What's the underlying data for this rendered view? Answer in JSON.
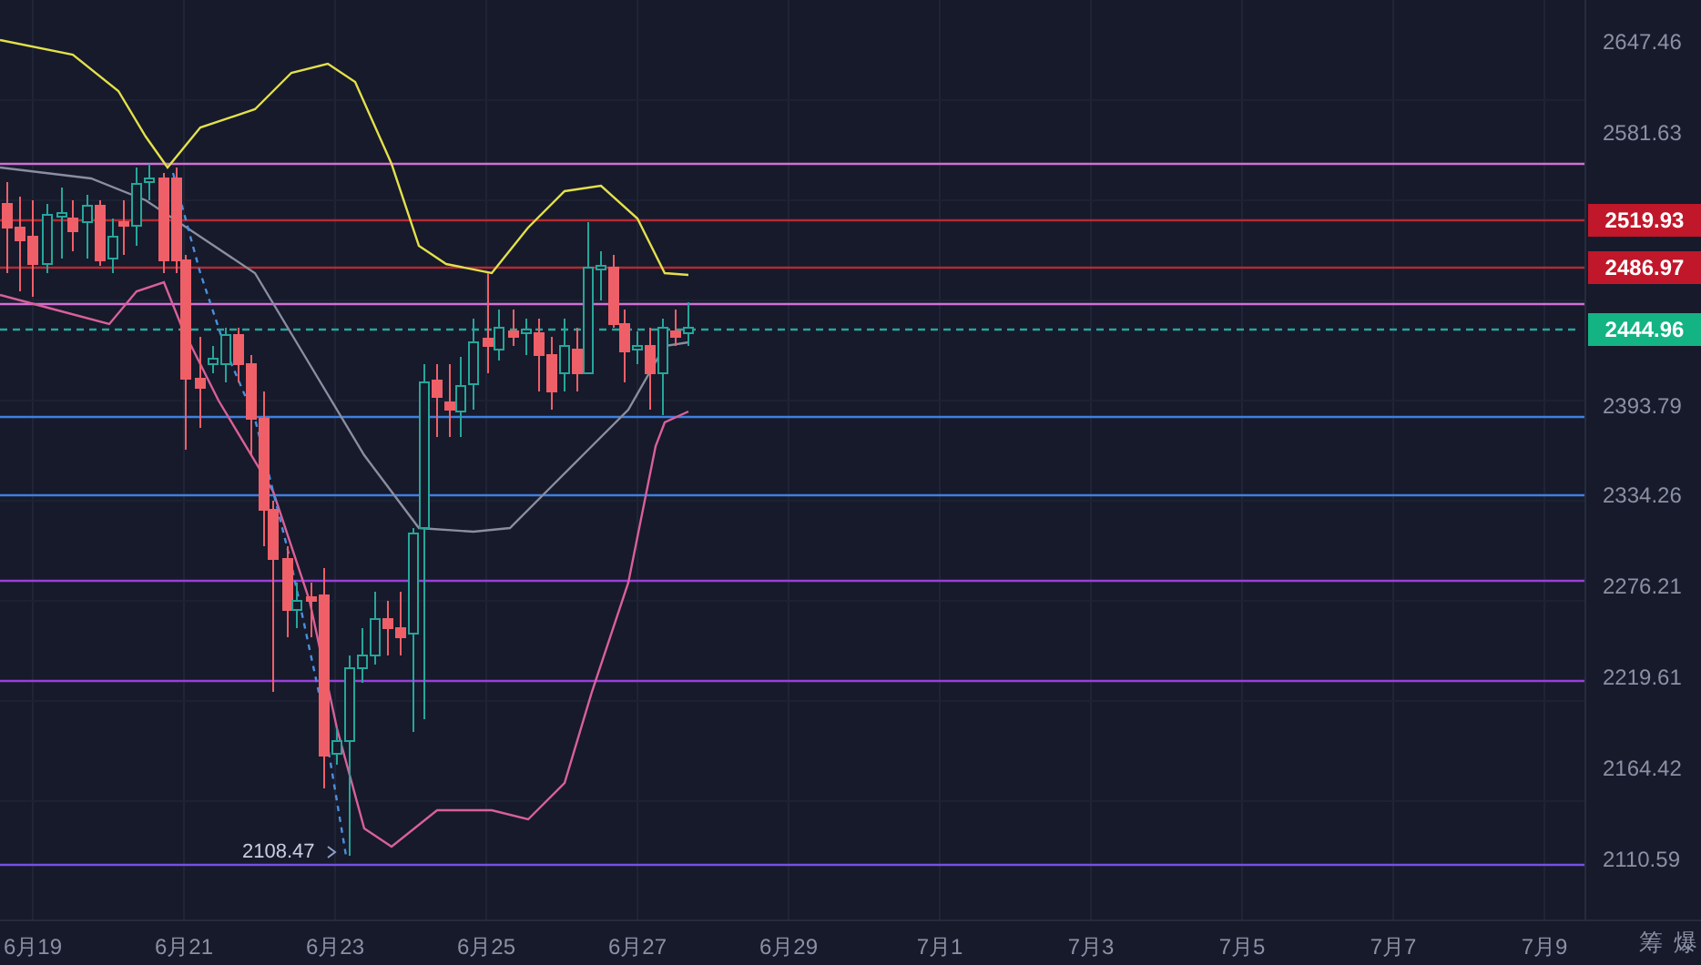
{
  "price_axis": {
    "ticks": [
      "2647.46",
      "2581.63",
      "2393.79",
      "2334.26",
      "2276.21",
      "2219.61",
      "2164.42",
      "2110.59"
    ]
  },
  "price_tags": [
    {
      "label": "2519.93",
      "color": "#c0172a"
    },
    {
      "label": "2486.97",
      "color": "#c0172a"
    },
    {
      "label": "2444.96",
      "color": "#14b383"
    }
  ],
  "low_marker": {
    "label": "2108.47"
  },
  "time_axis": {
    "ticks": [
      "6月19",
      "6月21",
      "6月23",
      "6月25",
      "6月27",
      "6月29",
      "7月1",
      "7月3",
      "7月5",
      "7月7",
      "7月9"
    ]
  },
  "toolbar_buttons": [
    "筹",
    "爆"
  ]
}
